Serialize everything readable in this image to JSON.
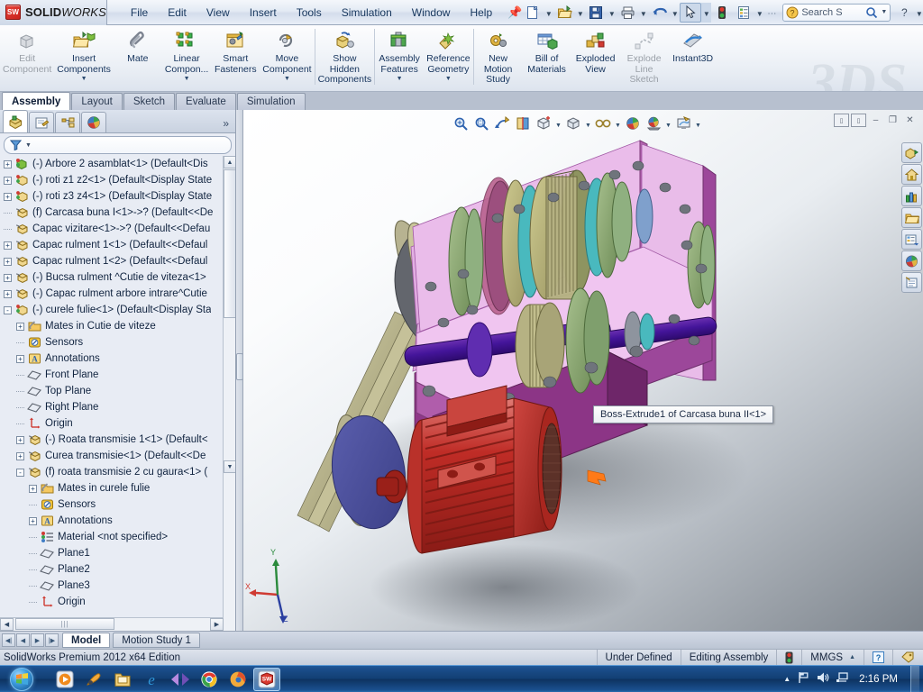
{
  "app": {
    "brand_sw": "SW",
    "brand_solid": "SOLID",
    "brand_works": "WORKS",
    "edition": "SolidWorks Premium 2012 x64 Edition"
  },
  "menu": {
    "items": [
      {
        "label": "File"
      },
      {
        "label": "Edit"
      },
      {
        "label": "View"
      },
      {
        "label": "Insert"
      },
      {
        "label": "Tools"
      },
      {
        "label": "Simulation"
      },
      {
        "label": "Window"
      },
      {
        "label": "Help"
      }
    ],
    "pin_icon": "pushpin-icon"
  },
  "quick_access": {
    "buttons": [
      {
        "name": "new-document",
        "glyph": "⬜"
      },
      {
        "name": "open-document",
        "glyph": "📂"
      },
      {
        "name": "save",
        "glyph": "💾"
      },
      {
        "name": "print",
        "glyph": "🖨"
      },
      {
        "name": "undo",
        "glyph": "↶"
      },
      {
        "name": "select",
        "glyph": "➤"
      },
      {
        "name": "rebuild",
        "glyph": "🚦"
      },
      {
        "name": "options",
        "glyph": "📋"
      },
      {
        "name": "more",
        "glyph": "⋯"
      }
    ],
    "search_placeholder": "Search S",
    "search_value": "Search S",
    "help_glyph": "?",
    "minimize": "–",
    "restore": "❐",
    "close": "✕"
  },
  "ribbon": {
    "groups": [
      {
        "buttons": [
          {
            "label": "Edit\nComponent",
            "name": "edit-component",
            "icon": "edit-component-icon",
            "dropdown": false,
            "disabled": true
          },
          {
            "label": "Insert\nComponents",
            "name": "insert-components",
            "icon": "insert-components-icon",
            "dropdown": true,
            "disabled": false
          },
          {
            "label": "Mate",
            "name": "mate",
            "icon": "mate-icon",
            "dropdown": false,
            "disabled": false
          },
          {
            "label": "Linear\nCompon...",
            "name": "linear-component-pattern",
            "icon": "linear-pattern-icon",
            "dropdown": true,
            "disabled": false
          },
          {
            "label": "Smart\nFasteners",
            "name": "smart-fasteners",
            "icon": "smart-fasteners-icon",
            "dropdown": false,
            "disabled": false
          },
          {
            "label": "Move\nComponent",
            "name": "move-component",
            "icon": "move-component-icon",
            "dropdown": true,
            "disabled": false
          },
          {
            "label": "Show\nHidden\nComponents",
            "name": "show-hidden-components",
            "icon": "show-hidden-icon",
            "dropdown": false,
            "disabled": false
          }
        ]
      },
      {
        "buttons": [
          {
            "label": "Assembly\nFeatures",
            "name": "assembly-features",
            "icon": "assembly-features-icon",
            "dropdown": true,
            "disabled": false
          },
          {
            "label": "Reference\nGeometry",
            "name": "reference-geometry",
            "icon": "reference-geometry-icon",
            "dropdown": true,
            "disabled": false
          }
        ]
      },
      {
        "buttons": [
          {
            "label": "New\nMotion\nStudy",
            "name": "new-motion-study",
            "icon": "motion-study-icon",
            "dropdown": false,
            "disabled": false
          },
          {
            "label": "Bill of\nMaterials",
            "name": "bill-of-materials",
            "icon": "bom-icon",
            "dropdown": false,
            "disabled": false
          },
          {
            "label": "Exploded\nView",
            "name": "exploded-view",
            "icon": "exploded-view-icon",
            "dropdown": false,
            "disabled": false
          },
          {
            "label": "Explode\nLine\nSketch",
            "name": "explode-line-sketch",
            "icon": "explode-line-icon",
            "dropdown": false,
            "disabled": true
          },
          {
            "label": "Instant3D",
            "name": "instant3d",
            "icon": "instant3d-icon",
            "dropdown": false,
            "disabled": false
          }
        ]
      }
    ]
  },
  "command_tabs": {
    "items": [
      {
        "label": "Assembly",
        "active": true
      },
      {
        "label": "Layout",
        "active": false
      },
      {
        "label": "Sketch",
        "active": false
      },
      {
        "label": "Evaluate",
        "active": false
      },
      {
        "label": "Simulation",
        "active": false
      }
    ]
  },
  "left_panel": {
    "tabs": [
      {
        "name": "feature-manager-tab",
        "icon": "feature-tree-icon",
        "active": true
      },
      {
        "name": "property-manager-tab",
        "icon": "property-manager-icon",
        "active": false
      },
      {
        "name": "configuration-manager-tab",
        "icon": "configuration-manager-icon",
        "active": false
      },
      {
        "name": "display-manager-tab",
        "icon": "display-manager-icon",
        "active": false
      }
    ],
    "expand_glyph": "»",
    "filter_icon": "filter-funnel-icon",
    "filter_value": "",
    "tree": [
      {
        "label": "(-) Arbore 2 asamblat<1>  (Default<Dis",
        "indent": 0,
        "expander": "+",
        "icon": "assembly-icon"
      },
      {
        "label": "(-) roti z1 z2<1>  (Default<Display State",
        "indent": 0,
        "expander": "+",
        "icon": "subassembly-icon"
      },
      {
        "label": "(-) roti z3 z4<1>  (Default<Display State",
        "indent": 0,
        "expander": "+",
        "icon": "subassembly-icon"
      },
      {
        "label": "(f) Carcasa buna I<1>->?  (Default<<De",
        "indent": 0,
        "expander": "",
        "icon": "part-icon"
      },
      {
        "label": "Capac vizitare<1>->?  (Default<<Defau",
        "indent": 0,
        "expander": "",
        "icon": "part-icon"
      },
      {
        "label": "Capac rulment 1<1>  (Default<<Defaul",
        "indent": 0,
        "expander": "+",
        "icon": "part-icon"
      },
      {
        "label": "Capac rulment 1<2>  (Default<<Defaul",
        "indent": 0,
        "expander": "+",
        "icon": "part-icon"
      },
      {
        "label": "(-) Bucsa rulment ^Cutie de viteza<1>",
        "indent": 0,
        "expander": "+",
        "icon": "part-icon"
      },
      {
        "label": "(-) Capac rulment arbore intrare^Cutie",
        "indent": 0,
        "expander": "+",
        "icon": "part-icon"
      },
      {
        "label": "(-) curele fulie<1>  (Default<Display Sta",
        "indent": 0,
        "expander": "-",
        "icon": "subassembly-icon"
      },
      {
        "label": "Mates in Cutie de viteze",
        "indent": 1,
        "expander": "+",
        "icon": "mates-folder-icon"
      },
      {
        "label": "Sensors",
        "indent": 1,
        "expander": "",
        "icon": "sensors-icon"
      },
      {
        "label": "Annotations",
        "indent": 1,
        "expander": "+",
        "icon": "annotations-icon"
      },
      {
        "label": "Front Plane",
        "indent": 1,
        "expander": "",
        "icon": "plane-icon"
      },
      {
        "label": "Top Plane",
        "indent": 1,
        "expander": "",
        "icon": "plane-icon"
      },
      {
        "label": "Right Plane",
        "indent": 1,
        "expander": "",
        "icon": "plane-icon"
      },
      {
        "label": "Origin",
        "indent": 1,
        "expander": "",
        "icon": "origin-icon"
      },
      {
        "label": "(-) Roata transmisie 1<1>  (Default<",
        "indent": 1,
        "expander": "+",
        "icon": "part-icon"
      },
      {
        "label": "Curea transmisie<1>  (Default<<De",
        "indent": 1,
        "expander": "+",
        "icon": "part-icon"
      },
      {
        "label": "(f) roata transmisie 2 cu gaura<1>  (",
        "indent": 1,
        "expander": "-",
        "icon": "part-icon"
      },
      {
        "label": "Mates in curele fulie",
        "indent": 2,
        "expander": "+",
        "icon": "mates-folder-icon"
      },
      {
        "label": "Sensors",
        "indent": 2,
        "expander": "",
        "icon": "sensors-icon"
      },
      {
        "label": "Annotations",
        "indent": 2,
        "expander": "+",
        "icon": "annotations-icon"
      },
      {
        "label": "Material <not specified>",
        "indent": 2,
        "expander": "",
        "icon": "material-icon"
      },
      {
        "label": "Plane1",
        "indent": 2,
        "expander": "",
        "icon": "plane-icon"
      },
      {
        "label": "Plane2",
        "indent": 2,
        "expander": "",
        "icon": "plane-icon"
      },
      {
        "label": "Plane3",
        "indent": 2,
        "expander": "",
        "icon": "plane-icon"
      },
      {
        "label": "Origin",
        "indent": 2,
        "expander": "",
        "icon": "origin-icon"
      }
    ]
  },
  "viewport": {
    "toolbar": [
      {
        "name": "zoom-to-fit-icon",
        "glyph": "🔍",
        "dropdown": false
      },
      {
        "name": "zoom-to-area-icon",
        "glyph": "🔎",
        "dropdown": false
      },
      {
        "name": "previous-view-icon",
        "glyph": "⤶",
        "dropdown": false
      },
      {
        "name": "section-view-icon",
        "glyph": "◫",
        "dropdown": false
      },
      {
        "name": "view-orientation-icon",
        "glyph": "⬚",
        "dropdown": true
      },
      {
        "name": "display-style-icon",
        "glyph": "▧",
        "dropdown": true
      },
      {
        "name": "hide-show-items-icon",
        "glyph": "👓",
        "dropdown": true
      },
      {
        "name": "edit-appearance-icon",
        "glyph": "◕",
        "dropdown": false
      },
      {
        "name": "apply-scene-icon",
        "glyph": "◔",
        "dropdown": true
      },
      {
        "name": "view-settings-icon",
        "glyph": "🖥",
        "dropdown": true
      }
    ],
    "window_buttons": [
      {
        "name": "restore-pane-left-icon",
        "glyph": "◧"
      },
      {
        "name": "restore-pane-right-icon",
        "glyph": "◫"
      },
      {
        "name": "minimize-document-icon",
        "glyph": "–"
      },
      {
        "name": "restore-document-icon",
        "glyph": "❐"
      },
      {
        "name": "close-document-icon",
        "glyph": "✕"
      }
    ],
    "right_toolbar": [
      {
        "name": "view-palette-icon",
        "glyph": "📐"
      },
      {
        "name": "appearances-home-icon",
        "glyph": "🏠"
      },
      {
        "name": "display-states-icon",
        "glyph": "📊"
      },
      {
        "name": "file-explorer-icon",
        "glyph": "📁"
      },
      {
        "name": "design-library-icon",
        "glyph": "🗂"
      },
      {
        "name": "appearances-scenes-icon",
        "glyph": "◕"
      },
      {
        "name": "custom-properties-icon",
        "glyph": "📜"
      }
    ],
    "tooltip": "Boss-Extrude1 of Carcasa buna II<1>",
    "triad_labels": {
      "x": "X",
      "y": "Y",
      "z": "Z"
    }
  },
  "model_tabs": {
    "nav": [
      "◀|",
      "◀",
      "▶",
      "|▶"
    ],
    "items": [
      {
        "label": "Model",
        "active": true
      },
      {
        "label": "Motion Study 1",
        "active": false
      }
    ]
  },
  "status_bar": {
    "left": "SolidWorks Premium 2012 x64 Edition",
    "under_defined": "Under Defined",
    "editing": "Editing Assembly",
    "rebuild_icon": "rebuild-traffic-light-icon",
    "units": "MMGS",
    "units_caret": "▲",
    "help_badge": "?",
    "tag_icon": "tag-icon"
  },
  "taskbar": {
    "start_name": "windows-start-orb",
    "items": [
      {
        "name": "media-player-icon",
        "glyph": "▶",
        "active": false
      },
      {
        "name": "winamp-icon",
        "glyph": "🎷",
        "active": false
      },
      {
        "name": "file-explorer-icon",
        "glyph": "🗂",
        "active": false
      },
      {
        "name": "internet-explorer-icon",
        "glyph": "e",
        "active": false
      },
      {
        "name": "media-center-icon",
        "glyph": "▶◀",
        "active": false
      },
      {
        "name": "google-chrome-icon",
        "glyph": "◉",
        "active": false
      },
      {
        "name": "mozilla-firefox-icon",
        "glyph": "●",
        "active": false
      },
      {
        "name": "solidworks-icon",
        "glyph": "SW",
        "active": true
      }
    ],
    "tray": [
      {
        "name": "show-hidden-icons-icon",
        "glyph": "▲"
      },
      {
        "name": "action-center-flag-icon",
        "glyph": "⚑"
      },
      {
        "name": "volume-icon",
        "glyph": "🔊"
      },
      {
        "name": "network-icon",
        "glyph": "🖧"
      }
    ],
    "clock": "2:16 PM"
  }
}
